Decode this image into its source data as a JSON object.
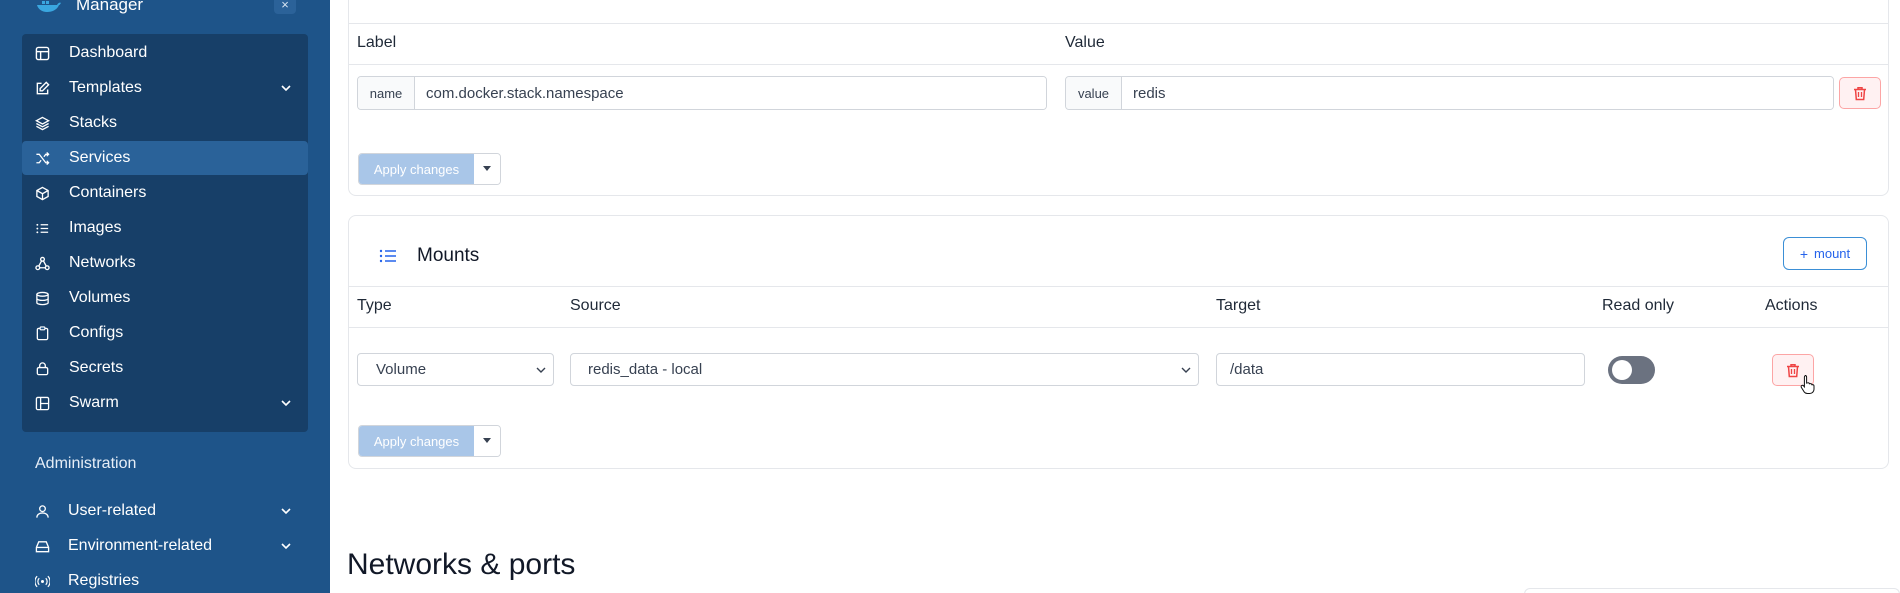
{
  "sidebar": {
    "brand": "Manager",
    "brand_close": "×",
    "items": [
      {
        "label": "Dashboard",
        "icon": "dashboard-icon"
      },
      {
        "label": "Templates",
        "icon": "edit-icon"
      },
      {
        "label": "Stacks",
        "icon": "layers-icon"
      },
      {
        "label": "Services",
        "icon": "shuffle-icon"
      },
      {
        "label": "Containers",
        "icon": "box-icon"
      },
      {
        "label": "Images",
        "icon": "list-icon"
      },
      {
        "label": "Networks",
        "icon": "network-icon"
      },
      {
        "label": "Volumes",
        "icon": "database-icon"
      },
      {
        "label": "Configs",
        "icon": "clipboard-icon"
      },
      {
        "label": "Secrets",
        "icon": "lock-icon"
      },
      {
        "label": "Swarm",
        "icon": "grid-icon"
      }
    ],
    "active_item": "Services",
    "admin_heading": "Administration",
    "admin_items": [
      {
        "label": "User-related",
        "icon": "user-icon"
      },
      {
        "label": "Environment-related",
        "icon": "hdd-icon"
      },
      {
        "label": "Registries",
        "icon": "radio-icon"
      }
    ]
  },
  "labels_panel": {
    "label_header": "Label",
    "value_header": "Value",
    "row": {
      "name_addon": "name",
      "name_value": "com.docker.stack.namespace",
      "value_addon": "value",
      "value_value": "redis"
    },
    "apply_label": "Apply changes"
  },
  "mounts_panel": {
    "title": "Mounts",
    "add_button": "mount",
    "columns": {
      "type": "Type",
      "source": "Source",
      "target": "Target",
      "read_only": "Read only",
      "actions": "Actions"
    },
    "row": {
      "type": "Volume",
      "source": "redis_data - local",
      "target": "/data",
      "read_only": false
    },
    "apply_label": "Apply changes"
  },
  "section_heading": "Networks & ports",
  "colors": {
    "sidebar_bg": "#1e5489",
    "sidebar_panel": "#173f68",
    "active_item": "#2a6299",
    "apply_disabled": "#a9c6e8",
    "danger": "#ef4444",
    "primary": "#3b8fd6"
  }
}
